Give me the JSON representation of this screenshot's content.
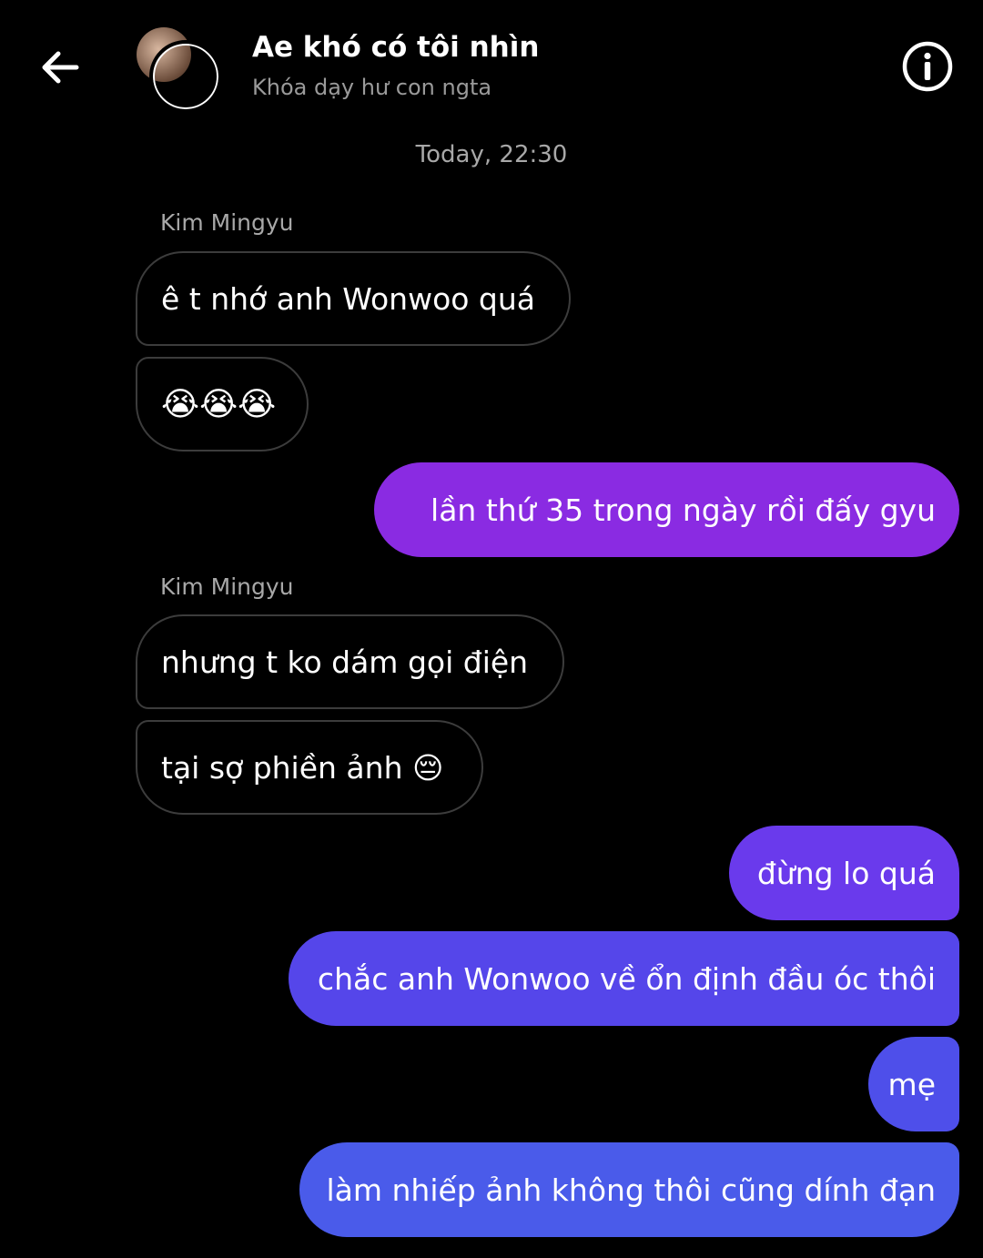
{
  "header": {
    "back_icon": "arrow-left-icon",
    "title": "Ae khó có tôi nhìn",
    "subtitle": "Khóa dạy hư con ngta",
    "info_icon": "info-icon"
  },
  "timestamp": "Today, 22:30",
  "colors": {
    "incoming_border": "#3c3c3c",
    "outgoing_top": "#8a2be2",
    "outgoing_bottom": "#4a5bea",
    "background": "#000000"
  },
  "messages": [
    {
      "sender": "Kim Mingyu",
      "direction": "in",
      "text": "ê t nhớ anh Wonwoo quá"
    },
    {
      "direction": "in",
      "text": "😭😭😭"
    },
    {
      "direction": "out",
      "text": "lần thứ 35 trong ngày rồi đấy gyu"
    },
    {
      "sender": "Kim Mingyu",
      "direction": "in",
      "text": "nhưng t ko dám gọi điện"
    },
    {
      "direction": "in",
      "text": "tại sợ phiền ảnh 😔"
    },
    {
      "direction": "out",
      "text": "đừng lo quá"
    },
    {
      "direction": "out",
      "text": "chắc anh Wonwoo về ổn định đầu óc thôi"
    },
    {
      "direction": "out",
      "text": "mẹ"
    },
    {
      "direction": "out",
      "text": "làm nhiếp ảnh không thôi cũng dính đạn"
    }
  ]
}
